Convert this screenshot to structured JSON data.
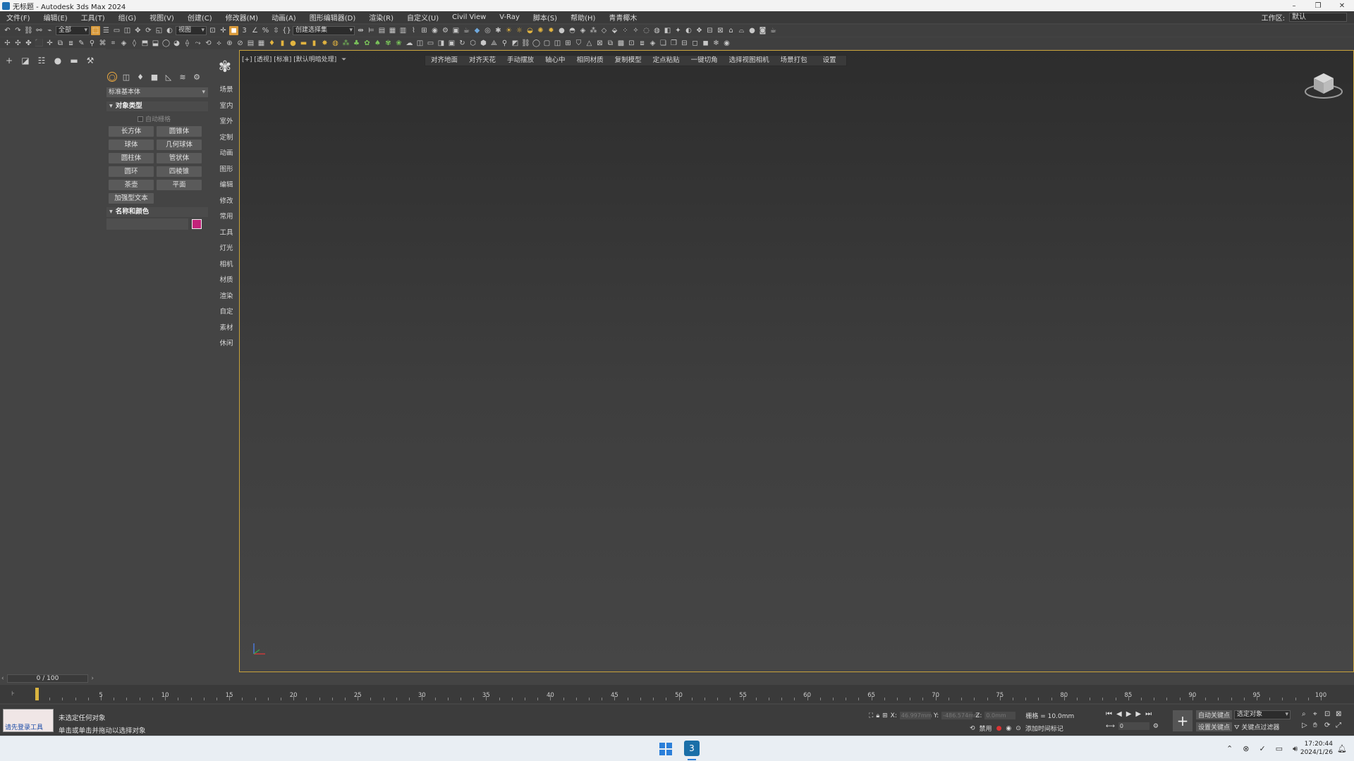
{
  "window": {
    "title": "无标题 - Autodesk 3ds Max 2024",
    "controls": [
      "–",
      "❐",
      "✕"
    ]
  },
  "menu": [
    "文件(F)",
    "编辑(E)",
    "工具(T)",
    "组(G)",
    "视图(V)",
    "创建(C)",
    "修改器(M)",
    "动画(A)",
    "图形编辑器(D)",
    "渲染(R)",
    "自定义(U)",
    "Civil View",
    "V-Ray",
    "脚本(S)",
    "帮助(H)",
    "青青椰木"
  ],
  "workspace": {
    "label": "工作区:",
    "value": "默认"
  },
  "toolbar": {
    "selection_filter": "全部",
    "ref_coord": "视图",
    "named_selection": "创建选择集"
  },
  "command_panel": {
    "category": "标准基本体",
    "object_type_title": "对象类型",
    "autogrid_label": "自动栅格",
    "buttons": [
      "长方体",
      "圆锥体",
      "球体",
      "几何球体",
      "圆柱体",
      "管状体",
      "圆环",
      "四棱锥",
      "茶壶",
      "平面",
      "加强型文本"
    ],
    "name_color_title": "名称和颜色",
    "color": "#c2237a"
  },
  "sidebar": [
    "场景",
    "室内",
    "室外",
    "定制",
    "动画",
    "图形",
    "编辑",
    "修改",
    "常用",
    "工具",
    "灯光",
    "相机",
    "材质",
    "渲染",
    "自定",
    "素材",
    "休闲"
  ],
  "viewport": {
    "label": "[+] [透视] [标准] [默认明暗处理]",
    "toolbar": [
      "对齐地面",
      "对齐天花",
      "手动摆放",
      "轴心中",
      "相同材质",
      "复制模型",
      "定点粘贴",
      "一键切角",
      "选择视图相机",
      "场景打包",
      "设置"
    ]
  },
  "timeline": {
    "frame_label": "0 / 100",
    "ticks": [
      "5",
      "10",
      "15",
      "20",
      "25",
      "30",
      "35",
      "40",
      "45",
      "50",
      "55",
      "60",
      "65",
      "70",
      "75",
      "80",
      "85",
      "90",
      "95",
      "100"
    ]
  },
  "status": {
    "maxscript": "请先登录工具",
    "line1": "未选定任何对象",
    "line2": "单击或单击并拖动以选择对象",
    "x_label": "X:",
    "x_value": "46.997mm",
    "y_label": "Y:",
    "y_value": "-486.574mm",
    "z_label": "Z:",
    "z_value": "0.0mm",
    "grid": "栅格 = 10.0mm",
    "disabled": "禁用",
    "add_time_tag": "添加时间标记",
    "auto_key": "自动关键点",
    "set_key": "设置关键点",
    "selected_object": "选定对象",
    "key_filter": "关键点过滤器",
    "frame_value": "0"
  },
  "taskbar": {
    "time": "17:20:44",
    "date": "2024/1/26"
  }
}
